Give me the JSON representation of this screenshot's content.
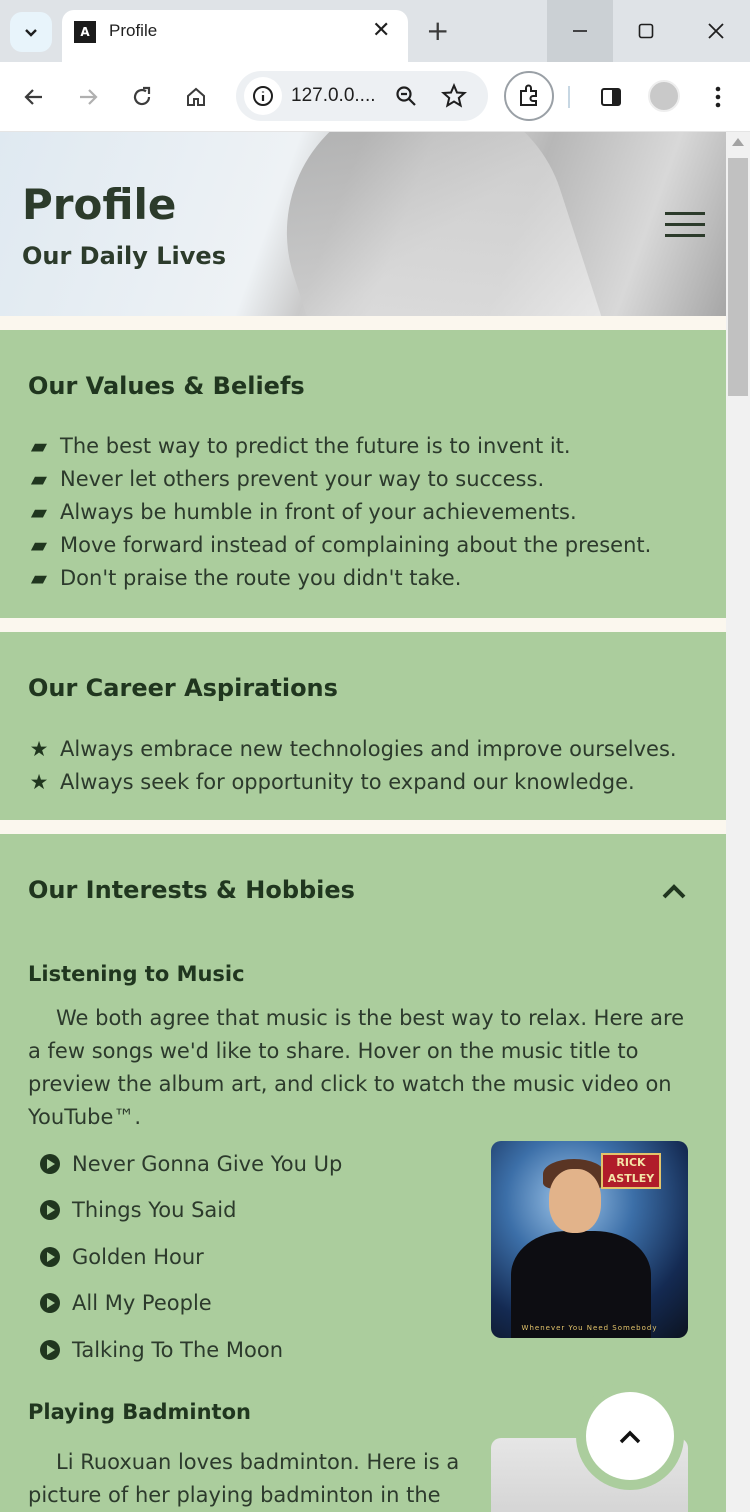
{
  "browser": {
    "tab_title": "Profile",
    "favicon_text": "A",
    "url": "127.0.0....",
    "new_tab": "+",
    "close_tab": "✕"
  },
  "header": {
    "title": "Profile",
    "subtitle": "Our Daily Lives"
  },
  "values": {
    "heading": "Our Values & Beliefs",
    "items": [
      "The best way to predict the future is to invent it.",
      "Never let others prevent your way to success.",
      "Always be humble in front of your achievements.",
      "Move forward instead of complaining about the present.",
      "Don't praise the route you didn't take."
    ]
  },
  "career": {
    "heading": "Our Career Aspirations",
    "items": [
      "Always embrace new technologies and improve ourselves.",
      "Always seek for opportunity to expand our knowledge."
    ]
  },
  "interests": {
    "heading": "Our Interests & Hobbies",
    "music_heading": "Listening to Music",
    "music_text": "We both agree that music is the best way to relax. Here are a few songs we'd like to share. Hover on the music title to preview the album art, and click to watch the music video on YouTube™.",
    "songs": [
      "Never Gonna Give You Up",
      "Things You Said",
      "Golden Hour",
      "All My People",
      "Talking To The Moon"
    ],
    "album_logo_top": "RICK",
    "album_logo_bottom": "ASTLEY",
    "album_caption": "Whenever You Need Somebody",
    "badminton_heading": "Playing Badminton",
    "badminton_text": "Li Ruoxuan loves badminton. Here is a picture of her playing badminton in the"
  },
  "icons": {
    "values_item": "book-icon",
    "career_item": "star-icon",
    "song_item": "play-icon"
  }
}
